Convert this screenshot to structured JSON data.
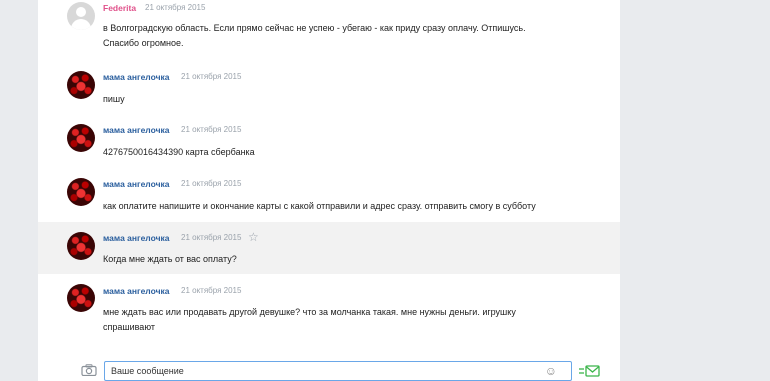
{
  "messages": [
    {
      "author": "Federita",
      "date": "21 октября 2015",
      "lines": [
        "в Волгоградскую область. Если прямо сейчас не успею - убегаю - как приду сразу оплачу. Отпишусь.",
        "Спасибо огромное."
      ]
    },
    {
      "author": "мама ангелочка",
      "date": "21 октября 2015",
      "lines": [
        "пишу"
      ]
    },
    {
      "author": "мама ангелочка",
      "date": "21 октября 2015",
      "lines": [
        "4276750016434390 карта сбербанка"
      ]
    },
    {
      "author": "мама ангелочка",
      "date": "21 октября 2015",
      "lines": [
        "как оплатите напишите и окончание карты с какой отправили и адрес сразу. отправить смогу в субботу"
      ]
    },
    {
      "author": "мама ангелочка",
      "date": "21 октября 2015",
      "lines": [
        "Когда мне ждать от вас оплату?"
      ]
    },
    {
      "author": "мама ангелочка",
      "date": "21 октября 2015",
      "lines": [
        "мне ждать вас или продавать другой девушке? что за молчанка такая. мне нужны деньги. игрушку",
        "спрашивают"
      ]
    }
  ],
  "composer": {
    "placeholder": "Ваше сообщение"
  },
  "icons": {
    "camera": "camera-icon",
    "smile": "smile-icon",
    "send": "send-icon",
    "star": "star-icon"
  }
}
